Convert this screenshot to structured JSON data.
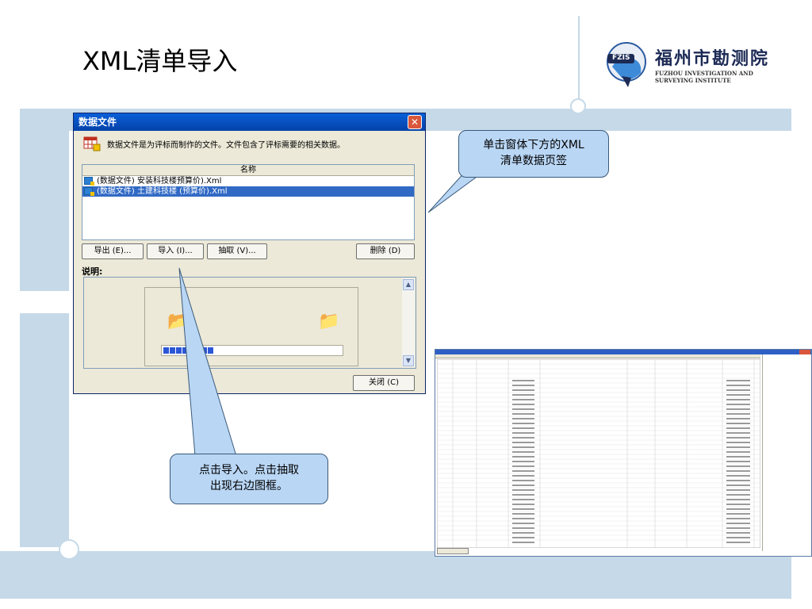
{
  "slide": {
    "title": "XML清单导入"
  },
  "logo": {
    "cn": "福州市勘测院",
    "en_line1": "FUZHOU INVESTIGATION AND",
    "en_line2": "SURVEYING INSTITUTE",
    "badge": "FZIS"
  },
  "dialog": {
    "title": "数据文件",
    "close_glyph": "✕",
    "description": "数据文件是为评标而制作的文件。文件包含了评标需要的相关数据。",
    "list_header": "名称",
    "files": [
      {
        "name": "(数据文件) 安装科技楼预算价).Xml",
        "selected": false
      },
      {
        "name": "(数据文件) 土建科技楼 (预算价).Xml",
        "selected": true
      }
    ],
    "buttons": {
      "export": "导出 (E)...",
      "import": "导入 (I)...",
      "extract": "抽取 (V)...",
      "delete": "删除 (D)",
      "close": "关闭 (C)"
    },
    "explain_label": "说明:",
    "progress_segments": 8
  },
  "callouts": {
    "top": "单击窗体下方的XML\n清单数据页签",
    "bottom": "点击导入。点击抽取\n出现右边图框。"
  },
  "colors": {
    "band": "#c5d9e8",
    "callout_fill": "#b9d6f5",
    "titlebar": "#0a5fd8",
    "selection": "#316ac5"
  }
}
